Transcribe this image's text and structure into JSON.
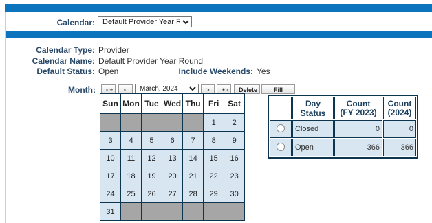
{
  "calendar_selector": {
    "label": "Calendar:",
    "selected": "Default Provider Year Round"
  },
  "details": {
    "type_label": "Calendar Type:",
    "type_value": "Provider",
    "name_label": "Calendar Name:",
    "name_value": "Default Provider Year Round",
    "status_label": "Default Status:",
    "status_value": "Open",
    "weekends_label": "Include Weekends:",
    "weekends_value": "Yes"
  },
  "month_nav": {
    "label": "Month:",
    "prev_year": "<+",
    "prev_month": "<",
    "selected_month": "March, 2024",
    "next_month": ">",
    "next_year": "+>",
    "delete": "Delete",
    "fill_month": "Fill Month"
  },
  "calendar": {
    "weekdays": [
      "Sun",
      "Mon",
      "Tue",
      "Wed",
      "Thu",
      "Fri",
      "Sat"
    ],
    "weeks": [
      [
        "",
        "",
        "",
        "",
        "",
        "1",
        "2"
      ],
      [
        "3",
        "4",
        "5",
        "6",
        "7",
        "8",
        "9"
      ],
      [
        "10",
        "11",
        "12",
        "13",
        "14",
        "15",
        "16"
      ],
      [
        "17",
        "18",
        "19",
        "20",
        "21",
        "22",
        "23"
      ],
      [
        "24",
        "25",
        "26",
        "27",
        "28",
        "29",
        "30"
      ],
      [
        "31",
        "",
        "",
        "",
        "",
        "",
        ""
      ]
    ]
  },
  "status_table": {
    "headers": [
      "",
      "Day Status",
      "Count\n(FY 2023)",
      "Count\n(2024)"
    ],
    "rows": [
      {
        "status": "Closed",
        "fy2023": "0",
        "y2024": "0"
      },
      {
        "status": "Open",
        "fy2023": "366",
        "y2024": "366"
      }
    ]
  }
}
